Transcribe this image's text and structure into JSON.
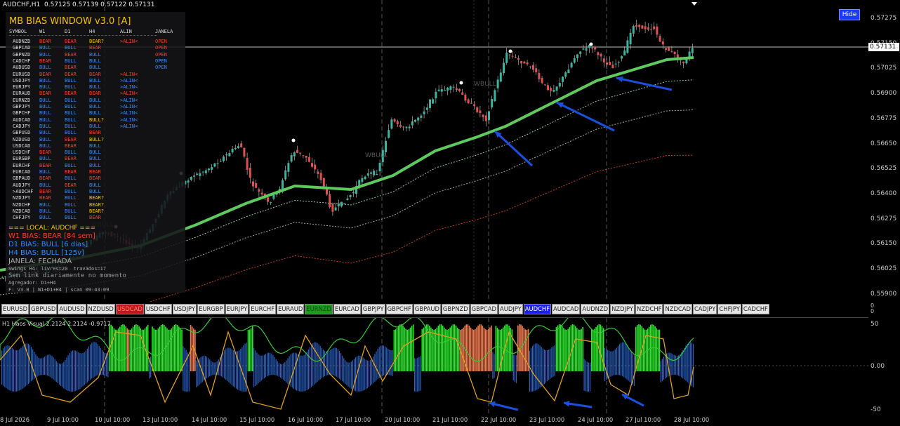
{
  "chart_header": "AUDCHF,H1  0.57125 0.57139 0.57122 0.57131",
  "hide_button": "Hide",
  "current_price": "0.57131",
  "price_levels": [
    "0.57275",
    "0.57150",
    "0.57025",
    "0.56900",
    "0.56775",
    "0.56650",
    "0.56525",
    "0.56400",
    "0.56275",
    "0.56150",
    "0.56025",
    "0.55900"
  ],
  "wbull_labels": [
    "WBULL",
    "WBULL",
    "WBULL"
  ],
  "bias_window": {
    "title": "MB BIAS WINDOW v3.0 [A]",
    "headers": {
      "symbol": "SYMBOL",
      "w1": "W1",
      "d1": "D1",
      "h4": "H4",
      "alin": "ALIN",
      "janela": "JANELA"
    },
    "rows": [
      {
        "sym": "AUDNZD",
        "w1": "BEAR",
        "d1": "BEAR",
        "h4": "BEAR?",
        "alin": ">ALIN<",
        "jan": "OPEN"
      },
      {
        "sym": "GBPCAD",
        "w1": "BULL",
        "d1": "BULL",
        "h4": "BEAR",
        "alin": "",
        "jan": "OPEN"
      },
      {
        "sym": "GBPNZD",
        "w1": "BULL",
        "d1": "BEAR",
        "h4": "BULL",
        "alin": "",
        "jan": "OPEN"
      },
      {
        "sym": "CADCHF",
        "w1": "BEAR",
        "d1": "BULL",
        "h4": "BULL",
        "alin": "",
        "jan": "OPEN"
      },
      {
        "sym": "AUDUSD",
        "w1": "BULL",
        "d1": "BEAR",
        "h4": "BULL",
        "alin": "",
        "jan": "OPEN"
      },
      {
        "sym": "EURUSD",
        "w1": "BEAR",
        "d1": "BEAR",
        "h4": "BEAR",
        "alin": ">ALIN<",
        "jan": ""
      },
      {
        "sym": "USDJPY",
        "w1": "BULL",
        "d1": "BULL",
        "h4": "BULL",
        "alin": ">ALIN<",
        "jan": ""
      },
      {
        "sym": "EURJPY",
        "w1": "BULL",
        "d1": "BULL",
        "h4": "BULL",
        "alin": ">ALIN<",
        "jan": ""
      },
      {
        "sym": "EURAUD",
        "w1": "BEAR",
        "d1": "BEAR",
        "h4": "BEAR",
        "alin": ">ALIN<",
        "jan": ""
      },
      {
        "sym": "EURNZD",
        "w1": "BULL",
        "d1": "BULL",
        "h4": "BULL",
        "alin": ">ALIN<",
        "jan": ""
      },
      {
        "sym": "GBPJPY",
        "w1": "BULL",
        "d1": "BULL",
        "h4": "BULL",
        "alin": ">ALIN<",
        "jan": ""
      },
      {
        "sym": "GBPCHF",
        "w1": "BULL",
        "d1": "BULL",
        "h4": "BULL",
        "alin": ">ALIN<",
        "jan": ""
      },
      {
        "sym": "AUDCAD",
        "w1": "BULL",
        "d1": "BULL",
        "h4": "BULL?",
        "alin": ">ALIN<",
        "jan": ""
      },
      {
        "sym": "CADJPY",
        "w1": "BULL",
        "d1": "BULL",
        "h4": "BULL",
        "alin": ">ALIN<",
        "jan": ""
      },
      {
        "sym": "GBPUSD",
        "w1": "BULL",
        "d1": "BULL",
        "h4": "BEAR",
        "alin": "",
        "jan": ""
      },
      {
        "sym": "NZDUSD",
        "w1": "BULL",
        "d1": "BEAR",
        "h4": "BULL?",
        "alin": "",
        "jan": ""
      },
      {
        "sym": "USDCAD",
        "w1": "BULL",
        "d1": "BEAR",
        "h4": "BULL",
        "alin": "",
        "jan": ""
      },
      {
        "sym": "USDCHF",
        "w1": "BEAR",
        "d1": "BULL",
        "h4": "BULL",
        "alin": "",
        "jan": ""
      },
      {
        "sym": "EURGBP",
        "w1": "BULL",
        "d1": "BEAR",
        "h4": "BULL",
        "alin": "",
        "jan": ""
      },
      {
        "sym": "EURCHF",
        "w1": "BEAR",
        "d1": "BULL",
        "h4": "BULL",
        "alin": "",
        "jan": ""
      },
      {
        "sym": "EURCAD",
        "w1": "BULL",
        "d1": "BEAR",
        "h4": "BEAR",
        "alin": "",
        "jan": ""
      },
      {
        "sym": "GBPAUD",
        "w1": "BEAR",
        "d1": "BULL",
        "h4": "BEAR",
        "alin": "",
        "jan": ""
      },
      {
        "sym": "AUDJPY",
        "w1": "BULL",
        "d1": "BEAR",
        "h4": "BULL",
        "alin": "",
        "jan": ""
      },
      {
        "sym": ">AUDCHF",
        "w1": "BEAR",
        "d1": "BULL",
        "h4": "BULL",
        "alin": "",
        "jan": ""
      },
      {
        "sym": "NZDJPY",
        "w1": "BEAR",
        "d1": "BULL",
        "h4": "BEAR?",
        "alin": "",
        "jan": ""
      },
      {
        "sym": "NZDCHF",
        "w1": "BULL",
        "d1": "BULL",
        "h4": "BEAR?",
        "alin": "",
        "jan": ""
      },
      {
        "sym": "NZDCAD",
        "w1": "BULL",
        "d1": "BULL",
        "h4": "BEAR?",
        "alin": "",
        "jan": ""
      },
      {
        "sym": "CHFJPY",
        "w1": "BULL",
        "d1": "BULL",
        "h4": "BEAR",
        "alin": "",
        "jan": ""
      }
    ],
    "local_title": "=== LOCAL: AUDCHF ===",
    "w1_bias": "W1 BIAS: BEAR [84 sem]",
    "d1_bias": "D1 BIAS: BULL [6 dias]",
    "h4_bias": "H4 BIAS: BULL [125v]",
    "janela": "JANELA: FECHADA",
    "swings": "Swings H4: livres=20  travados=17",
    "sem": "Sem link diariamente no momento",
    "agg": "Agregador: D1+H4",
    "footer": "F: V3.0 | W1+D1+H4 | scan 09:43:09"
  },
  "pairs": [
    {
      "label": "EURUSD",
      "state": "normal"
    },
    {
      "label": "GBPUSD",
      "state": "normal"
    },
    {
      "label": "AUDUSD",
      "state": "normal"
    },
    {
      "label": "NZDUSD",
      "state": "normal"
    },
    {
      "label": "USDCAD",
      "state": "red"
    },
    {
      "label": "USDCHF",
      "state": "normal"
    },
    {
      "label": "USDJPY",
      "state": "normal"
    },
    {
      "label": "EURGBP",
      "state": "normal"
    },
    {
      "label": "EURJPY",
      "state": "normal"
    },
    {
      "label": "EURCHF",
      "state": "normal"
    },
    {
      "label": "EURAUD",
      "state": "normal"
    },
    {
      "label": "EURNZD",
      "state": "green"
    },
    {
      "label": "EURCAD",
      "state": "normal"
    },
    {
      "label": "GBPJPY",
      "state": "normal"
    },
    {
      "label": "GBPCHF",
      "state": "normal"
    },
    {
      "label": "GBPAUD",
      "state": "normal"
    },
    {
      "label": "GBPNZD",
      "state": "normal"
    },
    {
      "label": "GBPCAD",
      "state": "normal"
    },
    {
      "label": "AUDJPY",
      "state": "normal"
    },
    {
      "label": "AUDCHF",
      "state": "blue"
    },
    {
      "label": "AUDCAD",
      "state": "normal"
    },
    {
      "label": "AUDNZD",
      "state": "normal"
    },
    {
      "label": "NZDJPY",
      "state": "normal"
    },
    {
      "label": "NZDCHF",
      "state": "normal"
    },
    {
      "label": "NZDCAD",
      "state": "normal"
    },
    {
      "label": "CADJPY",
      "state": "normal"
    },
    {
      "label": "CHFJPY",
      "state": "normal"
    },
    {
      "label": "CADCHF",
      "state": "normal"
    }
  ],
  "sub_window": {
    "title": "H1 Haos Visual 2.2124 2.2124 -0.9717",
    "levels": [
      "50",
      "0.00",
      "-50"
    ],
    "scale_top": [
      "0",
      "0"
    ]
  },
  "time_labels": [
    "8 Jul 2026",
    "9 Jul 10:00",
    "10 Jul 10:00",
    "13 Jul 10:00",
    "14 Jul 10:00",
    "15 Jul 10:00",
    "16 Jul 10:00",
    "17 Jul 10:00",
    "20 Jul 10:00",
    "21 Jul 10:00",
    "22 Jul 10:00",
    "23 Jul 10:00",
    "24 Jul 10:00",
    "27 Jul 10:00",
    "28 Jul 10:00"
  ],
  "colors": {
    "bull": "#2f8cff",
    "bear": "#ff3b1f",
    "ma": "#5ec95e",
    "candle_up": "#3cb4a0",
    "candle_down": "#e05050",
    "arrow": "#1a4fe0"
  }
}
